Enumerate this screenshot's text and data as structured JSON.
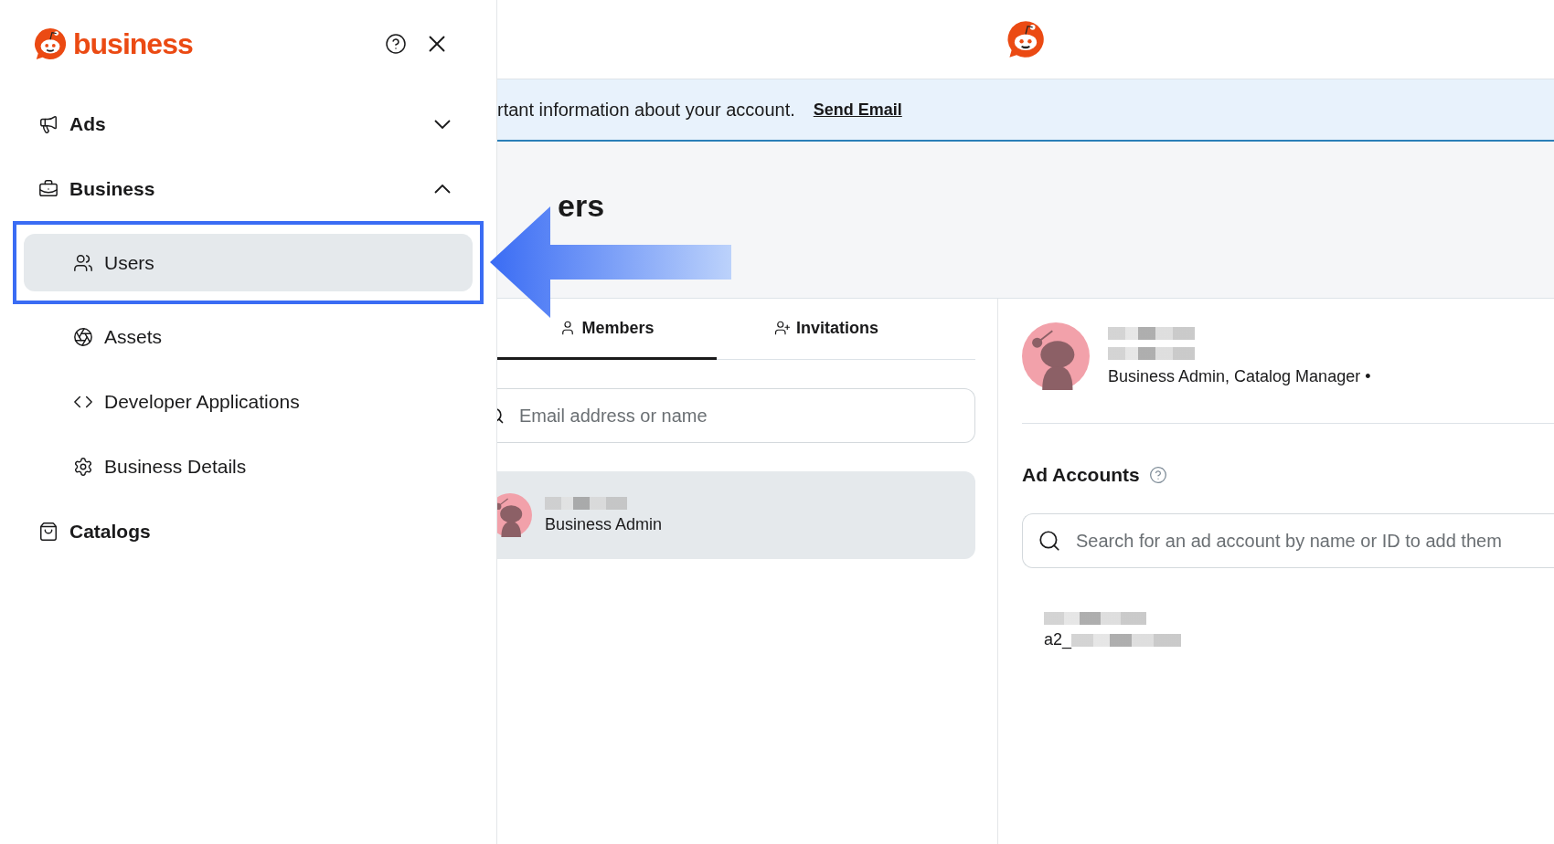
{
  "sidebar": {
    "brand": "business",
    "items": [
      {
        "label": "Ads",
        "expanded": false
      },
      {
        "label": "Business",
        "expanded": true,
        "children": [
          {
            "label": "Users",
            "selected": true
          },
          {
            "label": "Assets",
            "selected": false
          },
          {
            "label": "Developer Applications",
            "selected": false
          },
          {
            "label": "Business Details",
            "selected": false
          }
        ]
      },
      {
        "label": "Catalogs"
      }
    ]
  },
  "banner": {
    "text": "rtant information about your account.",
    "link": "Send Email"
  },
  "page_title": "ers",
  "tabs": [
    {
      "label": "Members",
      "selected": true
    },
    {
      "label": "Invitations",
      "selected": false
    }
  ],
  "member_search": {
    "placeholder": "Email address or name"
  },
  "members": [
    {
      "role": "Business Admin",
      "selected": true
    }
  ],
  "detail": {
    "roles": "Business Admin, Catalog Manager •",
    "ad_accounts_title": "Ad Accounts",
    "ad_search": {
      "placeholder": "Search for an ad account by name or ID to add them"
    },
    "accounts": [
      {
        "id_prefix": "a2_"
      }
    ]
  }
}
